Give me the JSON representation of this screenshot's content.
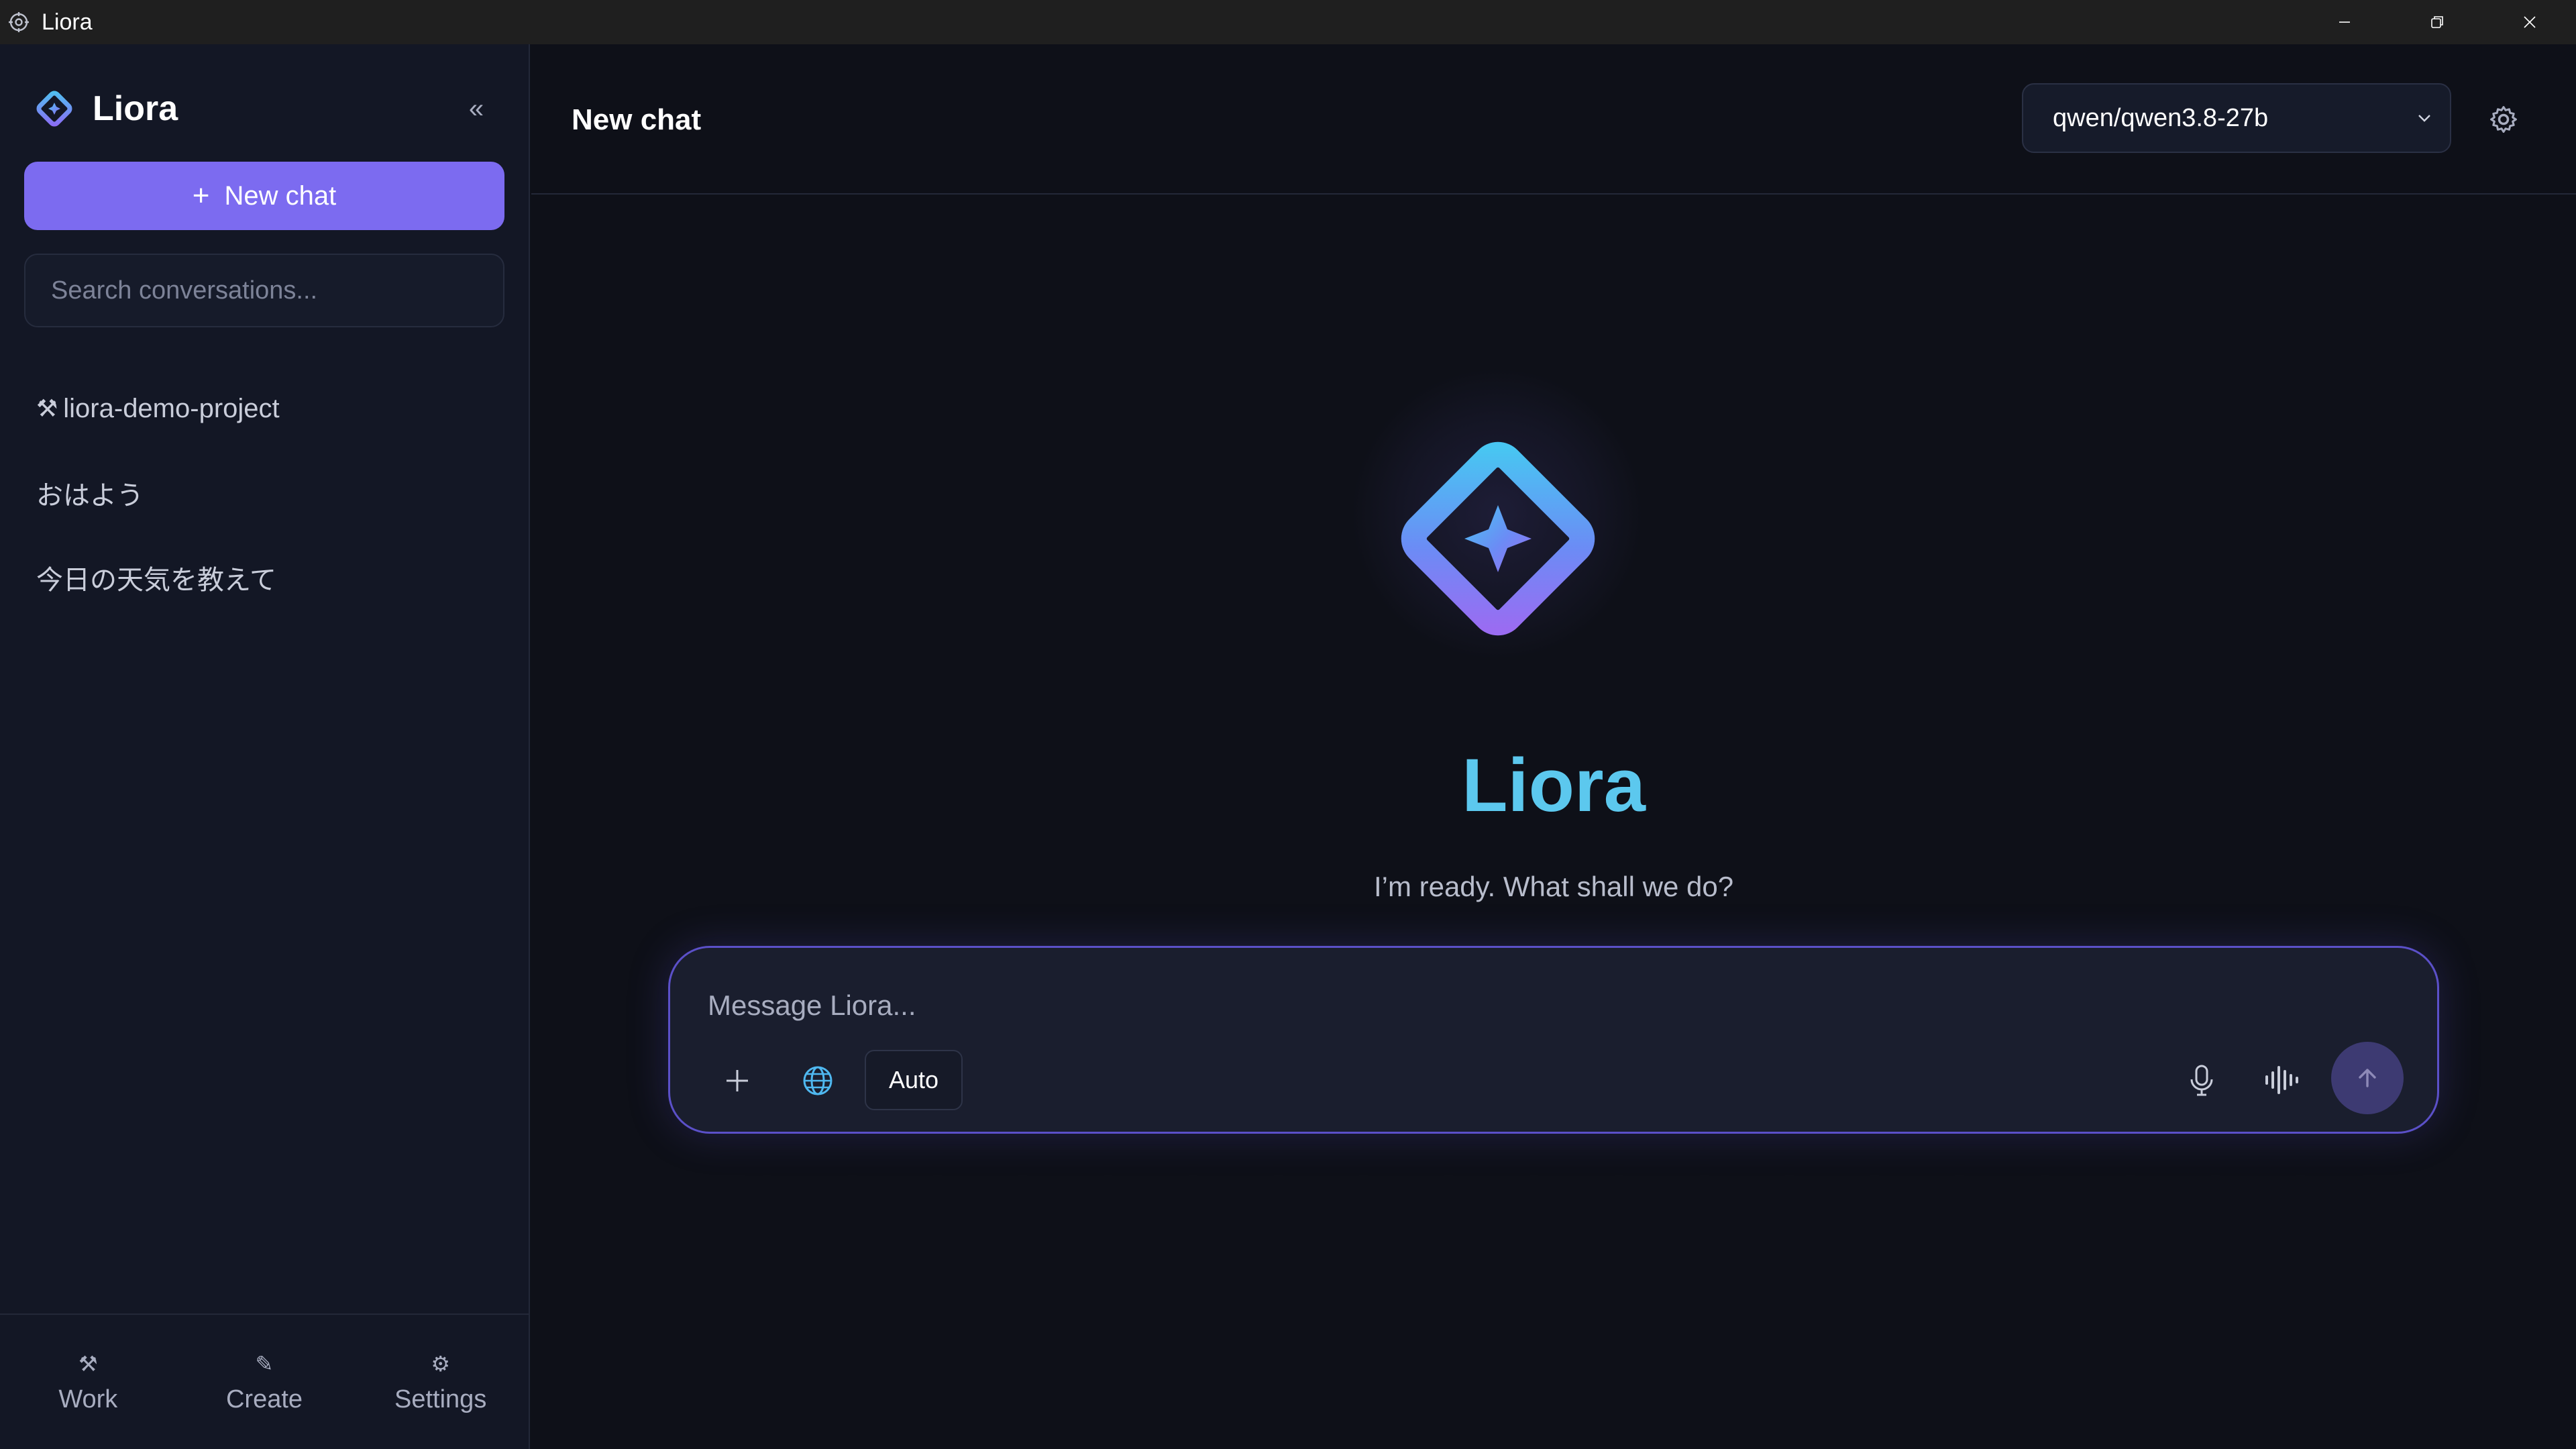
{
  "window": {
    "title": "Liora"
  },
  "sidebar": {
    "brand": "Liora",
    "collapse_label": "«",
    "new_chat_label": "New chat",
    "search_placeholder": "Search conversations...",
    "conversations": [
      {
        "glyph": "⚒",
        "label": "liora-demo-project"
      },
      {
        "label": "おはよう"
      },
      {
        "label": "今日の天気を教えて"
      }
    ],
    "footer": [
      {
        "icon": "⚒",
        "label": "Work"
      },
      {
        "icon": "✎",
        "label": "Create"
      },
      {
        "icon": "⚙",
        "label": "Settings"
      }
    ]
  },
  "main": {
    "title": "New chat",
    "model": "qwen/qwen3.8-27b",
    "hero": {
      "title": "Liora",
      "subtitle": "I’m ready. What shall we do?"
    },
    "composer": {
      "placeholder": "Message Liora...",
      "mode": "Auto"
    }
  },
  "colors": {
    "accent": "#7c6bf0",
    "brand_cyan": "#5cc8ee",
    "background": "#0e1018",
    "sidebar_bg": "#131725"
  },
  "icons": [
    "app-icon",
    "minimize-icon",
    "restore-icon",
    "close-icon",
    "diamond-logo-icon",
    "chevron-down-icon",
    "gear-icon",
    "plus-icon",
    "globe-icon",
    "microphone-icon",
    "waveform-icon",
    "arrow-up-icon"
  ]
}
